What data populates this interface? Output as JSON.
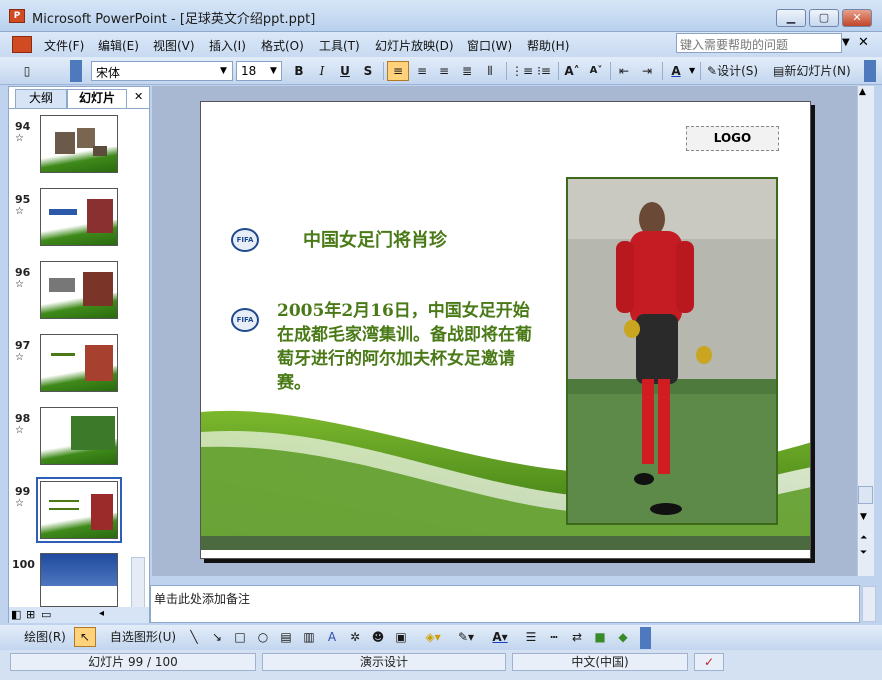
{
  "window": {
    "title": "Microsoft PowerPoint - [足球英文介绍ppt.ppt]",
    "app_icon_text": "P"
  },
  "menu": [
    "文件(F)",
    "编辑(E)",
    "视图(V)",
    "插入(I)",
    "格式(O)",
    "工具(T)",
    "幻灯片放映(D)",
    "窗口(W)",
    "帮助(H)"
  ],
  "help_placeholder": "键入需要帮助的问题",
  "toolbar": {
    "font": "宋体",
    "size": "18",
    "bold": "B",
    "italic": "I",
    "underline": "U",
    "shadow": "S",
    "design": "设计(S)",
    "new_slide": "新幻灯片(N)"
  },
  "panel_tabs": {
    "outline": "大纲",
    "slides": "幻灯片"
  },
  "thumbnails": [
    {
      "num": "94"
    },
    {
      "num": "95"
    },
    {
      "num": "96"
    },
    {
      "num": "97"
    },
    {
      "num": "98"
    },
    {
      "num": "99"
    },
    {
      "num": "100"
    }
  ],
  "slide": {
    "logo": "LOGO",
    "title": "中国女足门将肖珍",
    "body": "2005年2月16日，中国女足开始在成都毛家湾集训。备战即将在葡萄牙进行的阿尔加夫杯女足邀请赛。"
  },
  "notes_placeholder": "单击此处添加备注",
  "drawbar": {
    "draw": "绘图(R)",
    "autoshapes": "自选图形(U)"
  },
  "status": {
    "slide": "幻灯片 99 / 100",
    "design": "演示设计",
    "language": "中文(中国)"
  },
  "colors": {
    "accent_green": "#4a7a17",
    "selected_border": "#2d5fb8"
  }
}
